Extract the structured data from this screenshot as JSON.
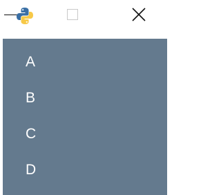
{
  "window": {
    "controls": {
      "minimize": "minimize-icon",
      "maximize": "maximize-icon",
      "close": "close-icon"
    },
    "app_icon": "python-icon"
  },
  "menu": {
    "items": [
      {
        "label": "A"
      },
      {
        "label": "B"
      },
      {
        "label": "C"
      },
      {
        "label": "D"
      }
    ]
  },
  "colors": {
    "panel_bg": "#647A8E",
    "item_text": "#FFFFFF",
    "titlebar_bg": "#FFFFFF",
    "python_blue": "#3A6FA5",
    "python_yellow": "#F7C948"
  }
}
